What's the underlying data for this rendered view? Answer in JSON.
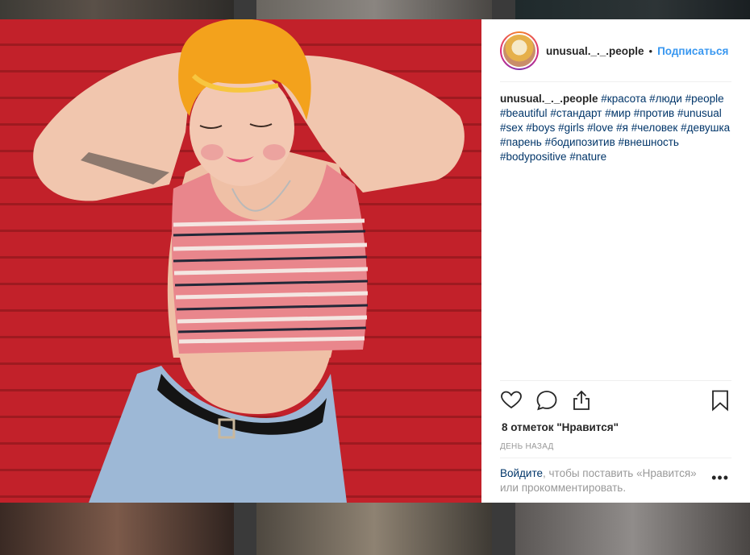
{
  "post": {
    "username": "unusual._._.people",
    "follow_label": "Подписаться",
    "caption_username": "unusual._._.people",
    "hashtags": [
      "#красота",
      "#люди",
      "#people",
      "#beautiful",
      "#стандарт",
      "#мир",
      "#против",
      "#unusual",
      "#sex",
      "#boys",
      "#girls",
      "#love",
      "#я",
      "#человек",
      "#девушка",
      "#парень",
      "#бодипозитив",
      "#внешность",
      "#bodypositive",
      "#nature"
    ],
    "likes": "8 отметок \"Нравится\"",
    "time": "ДЕНЬ НАЗАД",
    "login_link": "Войдите",
    "login_text": ", чтобы поставить «Нравится» или прокомментировать.",
    "more_label": "•••"
  },
  "icons": {
    "like": "heart-icon",
    "comment": "comment-icon",
    "share": "share-icon",
    "save": "bookmark-icon",
    "more": "more-icon"
  },
  "colors": {
    "link": "#003569",
    "follow": "#3897f0",
    "text": "#262626",
    "muted": "#999999",
    "wall": "#c2212a"
  }
}
